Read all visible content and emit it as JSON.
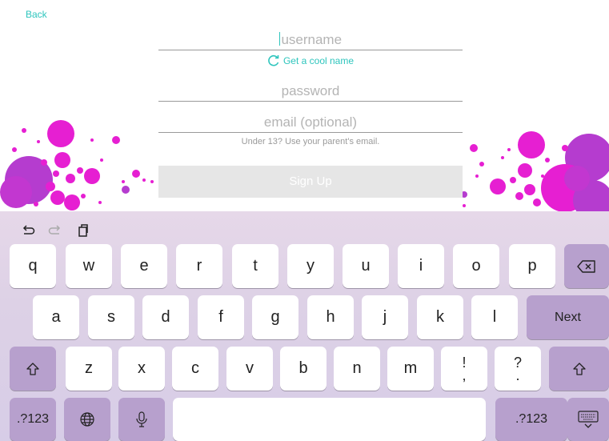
{
  "nav": {
    "back_label": "Back"
  },
  "form": {
    "username_placeholder": "username",
    "cool_name_label": "Get a cool name",
    "password_placeholder": "password",
    "email_placeholder": "email (optional)",
    "email_hint": "Under 13? Use your parent's email.",
    "signup_label": "Sign Up"
  },
  "colors": {
    "accent": "#2ec5bd",
    "magenta": "#e61fd2",
    "purple": "#b53ccf",
    "key_dark": "#b7a0cd",
    "keyboard_bg": "#ddd1e6"
  },
  "keyboard": {
    "toolbar_icons": [
      "undo-icon",
      "redo-icon",
      "paste-icon"
    ],
    "row1": [
      "q",
      "w",
      "e",
      "r",
      "t",
      "y",
      "u",
      "i",
      "o",
      "p"
    ],
    "row2": [
      "a",
      "s",
      "d",
      "f",
      "g",
      "h",
      "j",
      "k",
      "l"
    ],
    "row3": [
      "z",
      "x",
      "c",
      "v",
      "b",
      "n",
      "m"
    ],
    "punct1": {
      "top": "!",
      "bottom": ","
    },
    "punct2": {
      "top": "?",
      "bottom": "."
    },
    "next_label": "Next",
    "numbers_label_left": ".?123",
    "numbers_label_right": ".?123"
  }
}
